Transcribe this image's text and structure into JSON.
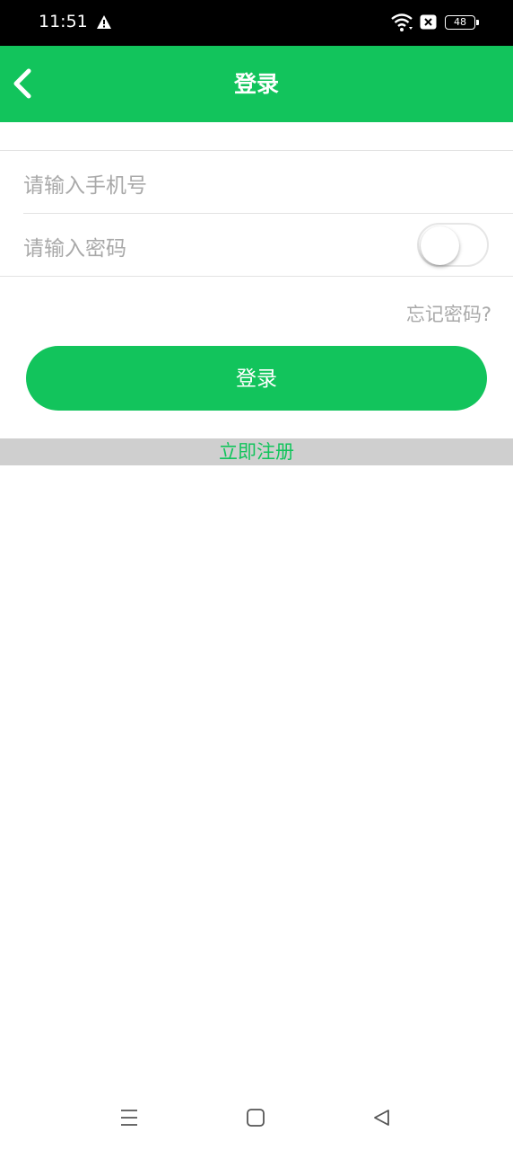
{
  "status_bar": {
    "time": "11:51",
    "battery": "48",
    "icons": [
      "warning-icon",
      "wifi-icon",
      "no-sim-icon",
      "battery-icon"
    ]
  },
  "header": {
    "title": "登录",
    "back_icon": "chevron-left-icon"
  },
  "form": {
    "phone_placeholder": "请输入手机号",
    "password_placeholder": "请输入密码",
    "password_visible": false,
    "forgot_label": "忘记密码?",
    "login_label": "登录"
  },
  "register": {
    "label": "立即注册"
  },
  "nav": {
    "icons": [
      "menu-icon",
      "home-icon",
      "back-icon"
    ]
  },
  "colors": {
    "accent": "#12c45c",
    "placeholder": "#a9a9a9",
    "register_bg": "#cfcfcf"
  }
}
